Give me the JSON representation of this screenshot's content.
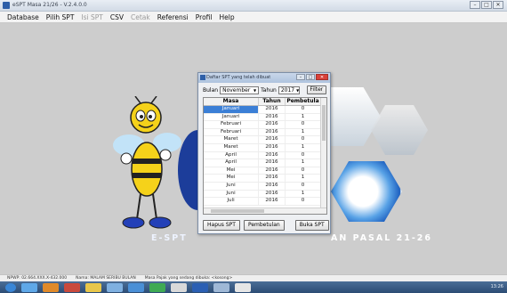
{
  "window": {
    "title": "eSPT Masa 21/26 - V.2.4.0.0",
    "controls": [
      "–",
      "□",
      "✕"
    ]
  },
  "menubar": {
    "items": [
      {
        "label": "Database",
        "enabled": true
      },
      {
        "label": "Pilih SPT",
        "enabled": true
      },
      {
        "label": "Isi SPT",
        "enabled": false
      },
      {
        "label": "CSV",
        "enabled": true
      },
      {
        "label": "Cetak",
        "enabled": false
      },
      {
        "label": "Referensi",
        "enabled": true
      },
      {
        "label": "Profil",
        "enabled": true
      },
      {
        "label": "Help",
        "enabled": true
      }
    ]
  },
  "artwork": {
    "banner_left": "E-SPT",
    "banner_right": "AN PASAL 21-26"
  },
  "dialog": {
    "title": "Daftar SPT yang telah dibuat",
    "bulan_label": "Bulan",
    "bulan_value": "November",
    "tahun_label": "Tahun",
    "tahun_value": "2017",
    "filter_label": "Filter",
    "columns": [
      "Masa",
      "Tahun",
      "Pembetula"
    ],
    "rows": [
      [
        "Januari",
        "2016",
        "0"
      ],
      [
        "Januari",
        "2016",
        "1"
      ],
      [
        "Februari",
        "2016",
        "0"
      ],
      [
        "Februari",
        "2016",
        "1"
      ],
      [
        "Maret",
        "2016",
        "0"
      ],
      [
        "Maret",
        "2016",
        "1"
      ],
      [
        "April",
        "2016",
        "0"
      ],
      [
        "April",
        "2016",
        "1"
      ],
      [
        "Mei",
        "2016",
        "0"
      ],
      [
        "Mei",
        "2016",
        "1"
      ],
      [
        "Juni",
        "2016",
        "0"
      ],
      [
        "Juni",
        "2016",
        "1"
      ],
      [
        "Juli",
        "2016",
        "0"
      ]
    ],
    "selected_row": 0,
    "buttons": {
      "hapus": "Hapus SPT",
      "pembetulan": "Pembetulan",
      "buka": "Buka SPT"
    }
  },
  "statusbar": {
    "npwp": "NPWP: 02.664.XXX.X-432.000",
    "nama": "Nama: MALAM SERIBU BULAN",
    "masa": "Masa Pajak yang sedang dibuka: <kosong>"
  },
  "taskbar": {
    "clock": "13:26"
  }
}
